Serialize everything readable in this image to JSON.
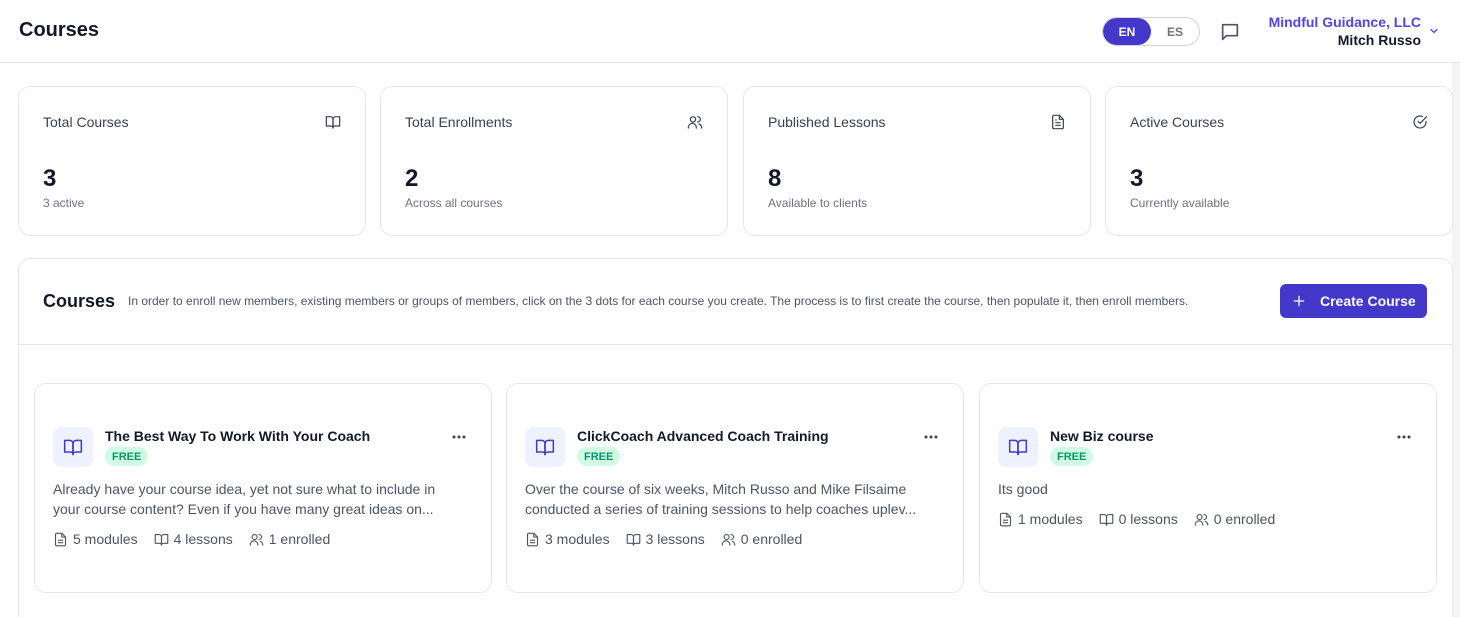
{
  "header": {
    "title": "Courses",
    "languages": [
      {
        "label": "EN",
        "active": true
      },
      {
        "label": "ES",
        "active": false
      }
    ],
    "account": {
      "org": "Mindful Guidance, LLC",
      "user": "Mitch Russo"
    }
  },
  "stats": [
    {
      "title": "Total Courses",
      "value": "3",
      "sub": "3 active",
      "icon": "book-open-icon"
    },
    {
      "title": "Total Enrollments",
      "value": "2",
      "sub": "Across all courses",
      "icon": "users-icon"
    },
    {
      "title": "Published Lessons",
      "value": "8",
      "sub": "Available to clients",
      "icon": "file-text-icon"
    },
    {
      "title": "Active Courses",
      "value": "3",
      "sub": "Currently available",
      "icon": "check-circle-icon"
    }
  ],
  "courses_panel": {
    "title": "Courses",
    "description": "In order to enroll new members, existing members or groups of members, click on the 3 dots for each course you create. The process is to first create the course, then populate it, then enroll members.",
    "create_button": "Create Course"
  },
  "courses": [
    {
      "title": "The Best Way To Work With Your Coach",
      "badge": "FREE",
      "desc_line1": "Already have your course idea, yet not sure what to include in",
      "desc_line2": "your course content? Even if you have many great ideas on...",
      "modules": "5 modules",
      "lessons": "4 lessons",
      "enrolled": "1 enrolled"
    },
    {
      "title": "ClickCoach Advanced Coach Training",
      "badge": "FREE",
      "desc_line1": "Over the course of six weeks, Mitch Russo and Mike Filsaime",
      "desc_line2": "conducted a series of training sessions to help coaches uplev...",
      "modules": "3 modules",
      "lessons": "3 lessons",
      "enrolled": "0 enrolled"
    },
    {
      "title": "New Biz course",
      "badge": "FREE",
      "desc_line1": "Its good",
      "desc_line2": "",
      "modules": "1 modules",
      "lessons": "0 lessons",
      "enrolled": "0 enrolled"
    }
  ],
  "colors": {
    "accent": "#4338ca",
    "org_link": "#4f46e5",
    "badge_bg": "#d1fae5",
    "badge_text": "#059669",
    "icon_bg": "#eef2ff",
    "icon_stroke": "#4338ca"
  }
}
